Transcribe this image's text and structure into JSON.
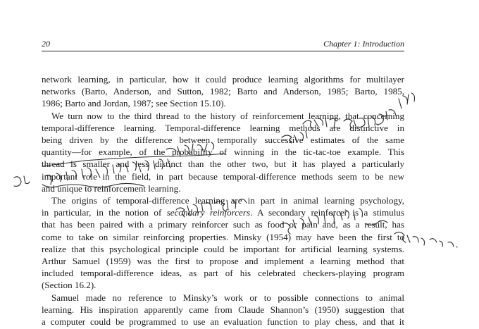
{
  "header": {
    "page_number": "20",
    "chapter": "Chapter 1: Introduction"
  },
  "paragraphs": [
    {
      "indent": false,
      "lines": [
        "network learning, in particular, how it could produce learning algorithms for multilayer",
        "networks (Barto, Anderson, and Sutton, 1982; Barto and Anderson, 1985; Barto, 1985,",
        "1986; Barto and Jordan, 1987; see Section 15.10)."
      ]
    },
    {
      "indent": true,
      "lines": [
        "We turn now to the third thread to the history of reinforcement learning, that concerning",
        "temporal-difference learning. Temporal-difference learning methods are distinctive in",
        "being driven by the difference between temporally successive estimates of the same",
        "quantity—for example, of the probability of winning in the tic-tac-toe example. This",
        "thread is smaller and less distinct than the other two, but it has played a particularly",
        "important role in the field, in part because temporal-difference methods seem to be new",
        "and unique to reinforcement learning."
      ]
    },
    {
      "indent": true,
      "lines": [
        "The origins of temporal-difference learning are in part in animal learning psychology,",
        "in particular, in the notion of secondary reinforcers. A secondary reinforcer is a stimulus",
        "that has been paired with a primary reinforcer such as food or pain and, as a result, has",
        "come to take on similar reinforcing properties. Minsky (1954) may have been the first to",
        "realize that this psychological principle could be important for artificial learning systems.",
        "Arthur Samuel (1959) was the first to propose and implement a learning method that",
        "included temporal-difference ideas, as part of his celebrated checkers-playing program",
        "(Section 16.2)."
      ]
    },
    {
      "indent": true,
      "lines": [
        "Samuel made no reference to Minsky’s work or to possible connections to animal",
        "learning. His inspiration apparently came from Claude Shannon’s (1950) suggestion that",
        "a computer could be programmed to use an evaluation function to play chess, and that it"
      ]
    }
  ],
  "handwritten_annotations": [
    "就是说，还是目标是当前",
    "然后说",
    "5月，是新颖的学习方法在强化学习中特有的方式",
    "次级强化",
    "是指次级强化物是与奖赏相关联的，如食物，经过条件反射形成的。"
  ]
}
